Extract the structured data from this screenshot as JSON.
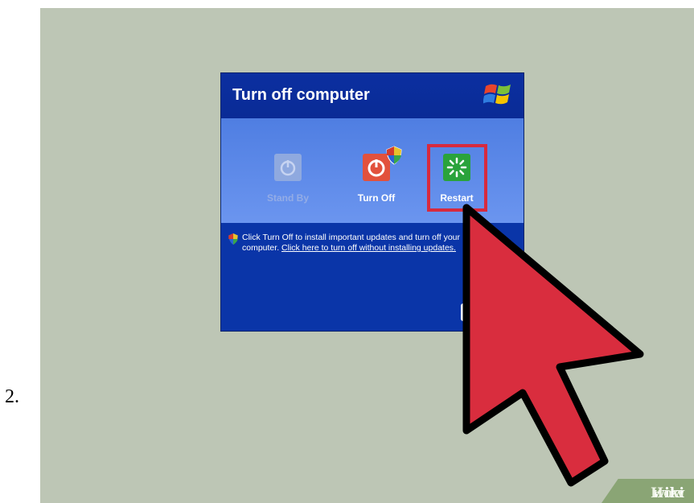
{
  "step": {
    "number": "2."
  },
  "dialog": {
    "title": "Turn off computer",
    "options": [
      {
        "label": "Stand By",
        "state": "disabled"
      },
      {
        "label": "Turn Off",
        "state": "enabled"
      },
      {
        "label": "Restart",
        "state": "highlighted"
      }
    ],
    "info_text": "Click Turn Off to install important updates and turn off your computer.",
    "link_text": "Click here to turn off without installing updates."
  },
  "cursor": {
    "color": "#d92d3e"
  },
  "brand": {
    "wiki": "wiki",
    "how": "How"
  },
  "colors": {
    "background": "#bdc6b5",
    "dialog_blue": "#0a35a8",
    "highlight_red": "#d72a3e"
  }
}
